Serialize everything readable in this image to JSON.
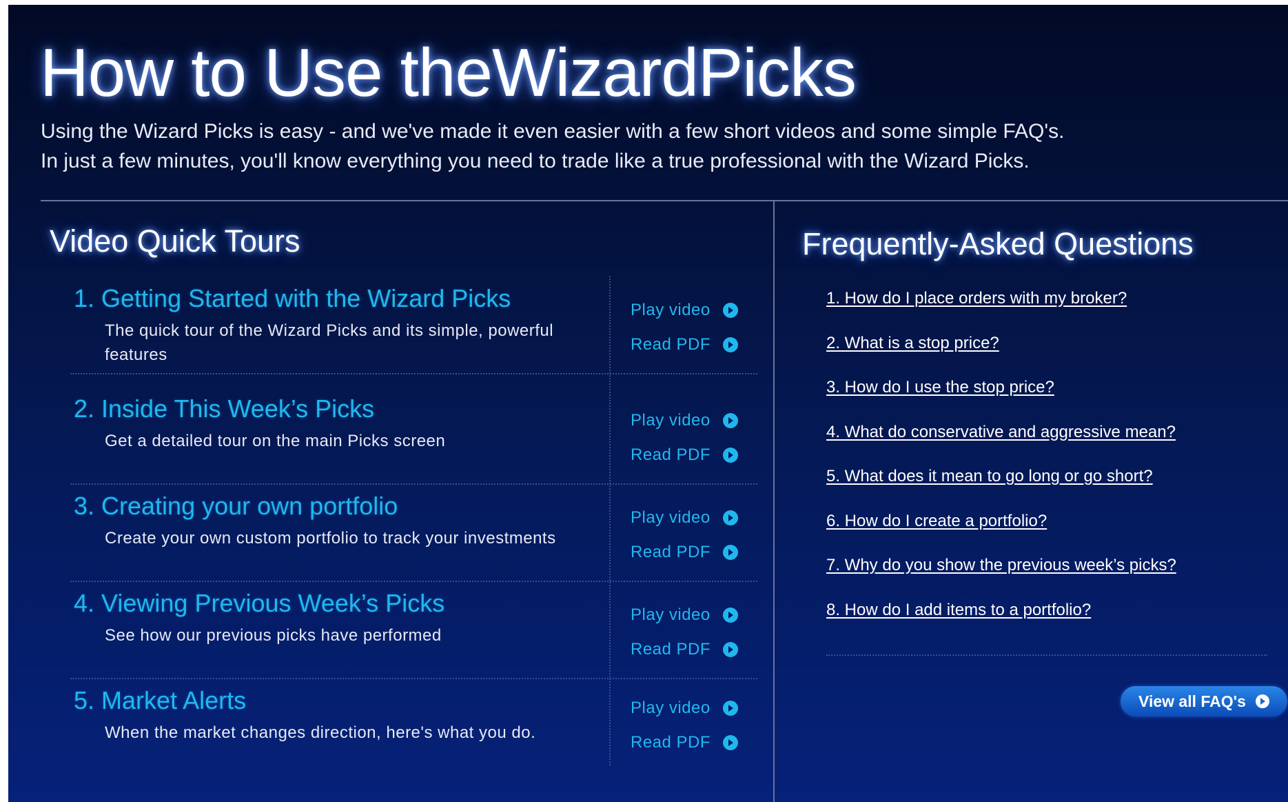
{
  "header": {
    "title": "How to Use theWizardPicks",
    "intro_line1": "Using the Wizard Picks is easy - and we've made it even easier with a few short videos and some simple FAQ's.",
    "intro_line2": "In just a few minutes, you'll know everything you need to trade like a true professional with the Wizard Picks."
  },
  "tours": {
    "section_title": "Video Quick Tours",
    "play_label": "Play video",
    "pdf_label": "Read PDF",
    "items": [
      {
        "title": "1. Getting Started with the Wizard Picks",
        "desc": "The quick tour of the Wizard Picks and its simple, powerful features"
      },
      {
        "title": "2. Inside This Week’s Picks",
        "desc": "Get a detailed tour on the main Picks screen"
      },
      {
        "title": "3. Creating your own portfolio",
        "desc": "Create your own custom portfolio to track your investments"
      },
      {
        "title": "4. Viewing Previous Week’s Picks",
        "desc": "See how our previous picks have performed"
      },
      {
        "title": "5. Market Alerts",
        "desc": "When the market changes direction, here's what you do."
      }
    ]
  },
  "faq": {
    "section_title": "Frequently-Asked Questions",
    "items": [
      "1. How do I place orders with my broker?",
      "2. What is a stop price?",
      "3. How do I use the stop price?",
      "4. What do conservative and aggressive mean?",
      "5. What does it mean to go long or go short?",
      "6. How do I create a portfolio?",
      "7. Why do you show the previous week’s picks?",
      "8. How do I add items to a portfolio?"
    ],
    "view_all_label": "View all FAQ's"
  },
  "colors": {
    "accent": "#1fb8ee",
    "background_top": "#020a26",
    "background_bottom": "#06217a",
    "button": "#1a66d0"
  }
}
